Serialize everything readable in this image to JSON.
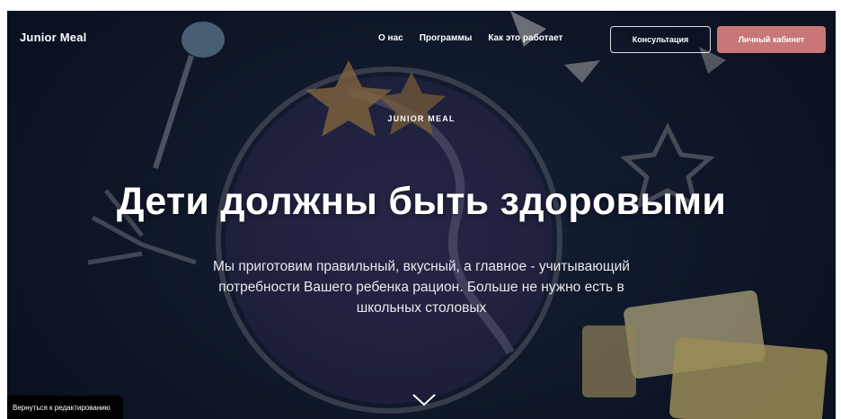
{
  "nav": {
    "brand": "Junior Meal",
    "links": [
      "О нас",
      "Программы",
      "Как это работает"
    ],
    "consult_button": "Консультация",
    "account_button": "Личный кабинет"
  },
  "hero": {
    "eyebrow": "JUNIOR MEAL",
    "headline": "Дети должны быть здоровыми",
    "subtitle": "Мы приготовим правильный, вкусный, а главное - учитывающий потребности Вашего ребенка рацион. Больше не нужно есть в школьных столовых"
  },
  "edit_badge": "Вернуться к редактированию",
  "icons": {
    "scroll_down": "chevron-down-icon"
  },
  "colors": {
    "accent": "#c97677",
    "background": "#142036"
  }
}
